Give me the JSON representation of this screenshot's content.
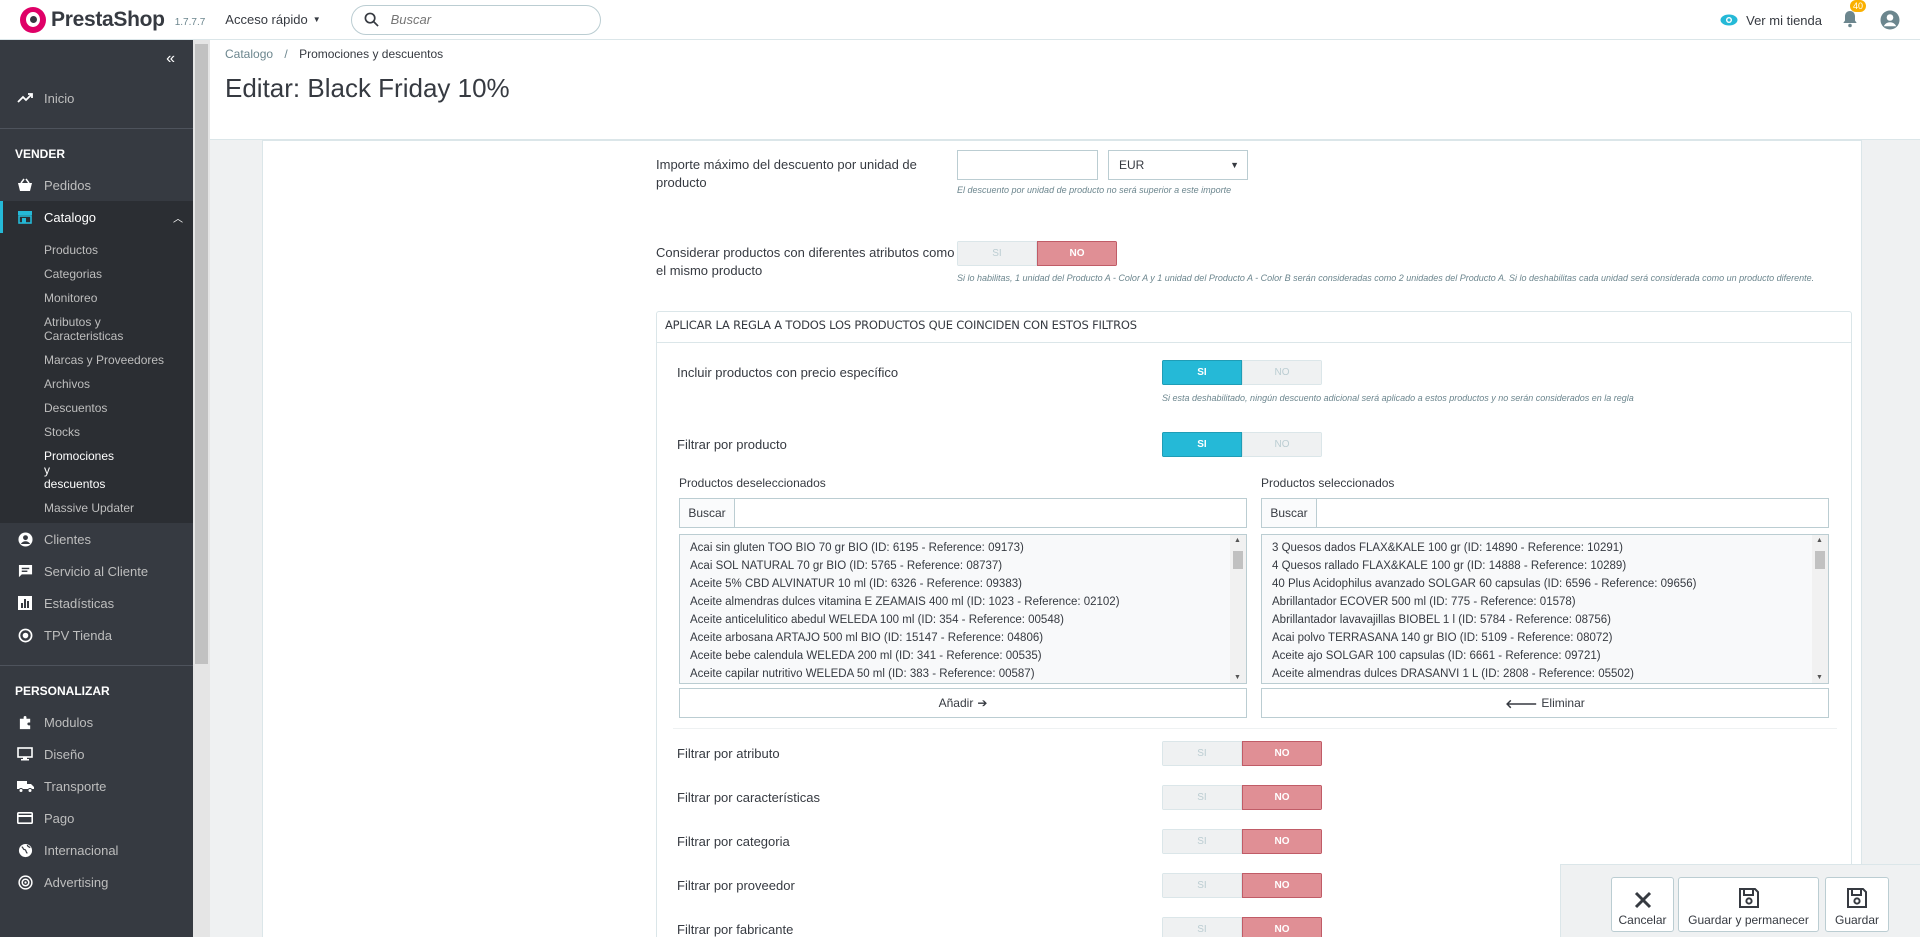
{
  "header": {
    "brand": "PrestaShop",
    "version": "1.7.7.7",
    "quick_access": "Acceso rápido",
    "search_placeholder": "Buscar",
    "view_shop": "Ver mi tienda",
    "notifications": "40"
  },
  "sidebar": {
    "home": "Inicio",
    "section_sell": "VENDER",
    "orders": "Pedidos",
    "catalog": "Catalogo",
    "catalog_sub": [
      "Productos",
      "Categorias",
      "Monitoreo",
      "Atributos y Caracteristicas",
      "Marcas y Proveedores",
      "Archivos",
      "Descuentos",
      "Stocks",
      "Promociones y descuentos",
      "Massive Updater"
    ],
    "clients": "Clientes",
    "customer_service": "Servicio al Cliente",
    "stats": "Estadísticas",
    "pos": "TPV Tienda",
    "section_customize": "PERSONALIZAR",
    "modules": "Modulos",
    "design": "Diseño",
    "shipping": "Transporte",
    "payment": "Pago",
    "international": "Internacional",
    "advertising": "Advertising"
  },
  "breadcrumb": {
    "parent": "Catalogo",
    "separator": "/",
    "current": "Promociones y descuentos"
  },
  "page_title": "Editar: Black Friday 10%",
  "form": {
    "max_discount_label": "Importe máximo del descuento por unidad de producto",
    "currency": "EUR",
    "max_discount_help": "El descuento por unidad de producto no será superior a este importe",
    "same_product_label": "Considerar productos con diferentes atributos como el mismo producto",
    "same_product_help": "Si lo habilitas, 1 unidad del Producto A - Color A y 1 unidad del Producto A - Color B serán consideradas como 2 unidades del Producto A. Si lo deshabilitas cada unidad será considerada como un producto diferente.",
    "yes": "SI",
    "no": "NO"
  },
  "filters_panel": {
    "title": "APLICAR LA REGLA A TODOS LOS PRODUCTOS QUE COINCIDEN CON ESTOS FILTROS",
    "include_specific_label": "Incluir productos con precio específico",
    "include_specific_help": "Si esta deshabilitado, ningún descuento adicional será aplicado a estos productos y no serán considerados en la regla",
    "filter_product_label": "Filtrar por producto",
    "unselected_label": "Productos deseleccionados",
    "selected_label": "Productos seleccionados",
    "search_label": "Buscar",
    "unselected_items": [
      "Acai sin gluten TOO BIO 70 gr BIO (ID: 6195 - Reference: 09173)",
      "Acai SOL NATURAL 70 gr BIO (ID: 5765 - Reference: 08737)",
      "Aceite 5% CBD ALVINATUR 10 ml (ID: 6326 - Reference: 09383)",
      "Aceite almendras dulces vitamina E ZEAMAIS 400 ml (ID: 1023 - Reference: 02102)",
      "Aceite anticelulitico abedul WELEDA 100 ml (ID: 354 - Reference: 00548)",
      "Aceite arbosana ARTAJO 500 ml BIO (ID: 15147 - Reference: 04806)",
      "Aceite bebe calendula WELEDA 200 ml (ID: 341 - Reference: 00535)",
      "Aceite capilar nutritivo WELEDA 50 ml (ID: 383 - Reference: 00587)"
    ],
    "selected_items": [
      "3 Quesos dados FLAX&KALE 100 gr (ID: 14890 - Reference: 10291)",
      "4 Quesos rallado FLAX&KALE 100 gr (ID: 14888 - Reference: 10289)",
      "40 Plus Acidophilus avanzado SOLGAR 60 capsulas (ID: 6596 - Reference: 09656)",
      "Abrillantador ECOVER 500 ml (ID: 775 - Reference: 01578)",
      "Abrillantador lavavajillas BIOBEL 1 l (ID: 5784 - Reference: 08756)",
      "Acai polvo TERRASANA 140 gr BIO (ID: 5109 - Reference: 08072)",
      "Aceite ajo SOLGAR 100 capsulas (ID: 6661 - Reference: 09721)",
      "Aceite almendras dulces DRASANVI 1 L (ID: 2808 - Reference: 05502)"
    ],
    "add_button": "Añadir",
    "remove_button": "Eliminar",
    "filter_attribute": "Filtrar por atributo",
    "filter_features": "Filtrar por características",
    "filter_category": "Filtrar por categoria",
    "filter_supplier": "Filtrar por proveedor",
    "filter_manufacturer": "Filtrar por fabricante"
  },
  "footer": {
    "cancel": "Cancelar",
    "save_stay": "Guardar y permanecer",
    "save": "Guardar"
  },
  "colors": {
    "accent": "#25b9d7",
    "no_active": "#e08f95",
    "sidebar": "#363a41"
  }
}
